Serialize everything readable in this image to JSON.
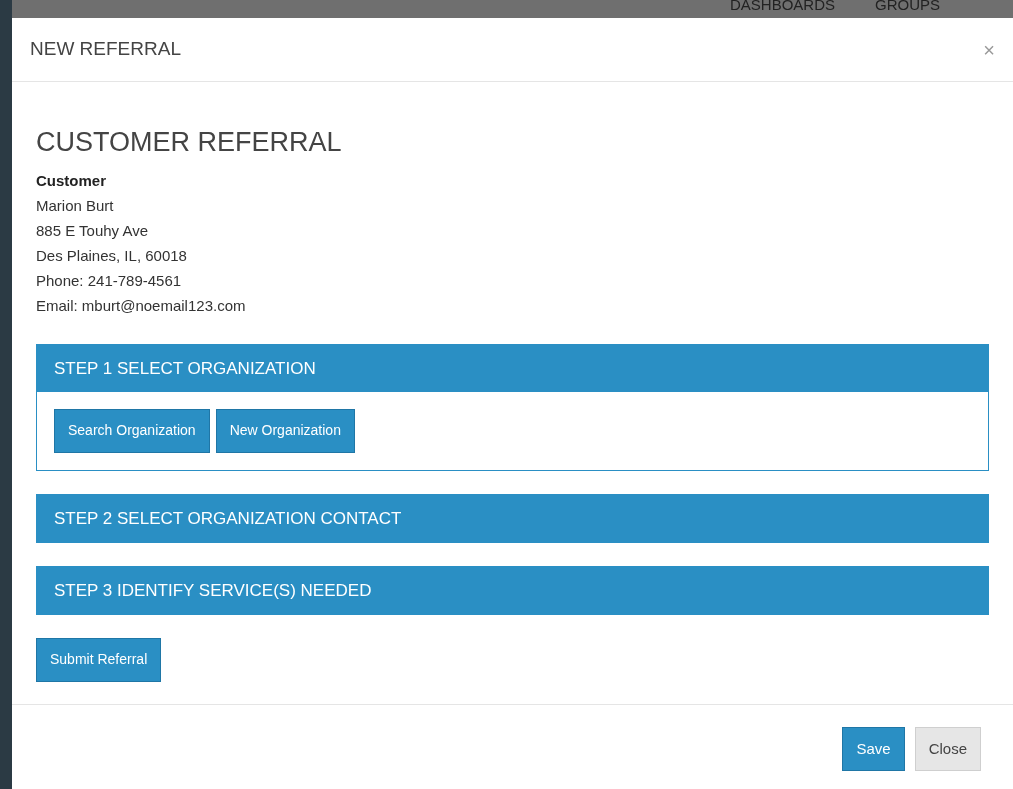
{
  "nav": {
    "items": [
      "DASHBOARDS",
      "GROUPS"
    ]
  },
  "modal": {
    "title": "NEW REFERRAL",
    "close": "×"
  },
  "heading": "CUSTOMER REFERRAL",
  "customer": {
    "label": "Customer",
    "lines": [
      "Marion Burt",
      "885 E Touhy Ave",
      "Des Plaines, IL, 60018",
      "Phone: 241-789-4561",
      "Email: mburt@noemail123.com"
    ]
  },
  "steps": [
    {
      "title": "STEP 1 SELECT ORGANIZATION",
      "expanded": true,
      "buttons": [
        "Search Organization",
        "New Organization"
      ]
    },
    {
      "title": "STEP 2 SELECT ORGANIZATION CONTACT",
      "expanded": false
    },
    {
      "title": "STEP 3 IDENTIFY SERVICE(S) NEEDED",
      "expanded": false
    }
  ],
  "submit": "Submit Referral",
  "footer": {
    "buttons": [
      {
        "label": "Save",
        "kind": "primary"
      },
      {
        "label": "Close",
        "kind": "default"
      }
    ]
  }
}
